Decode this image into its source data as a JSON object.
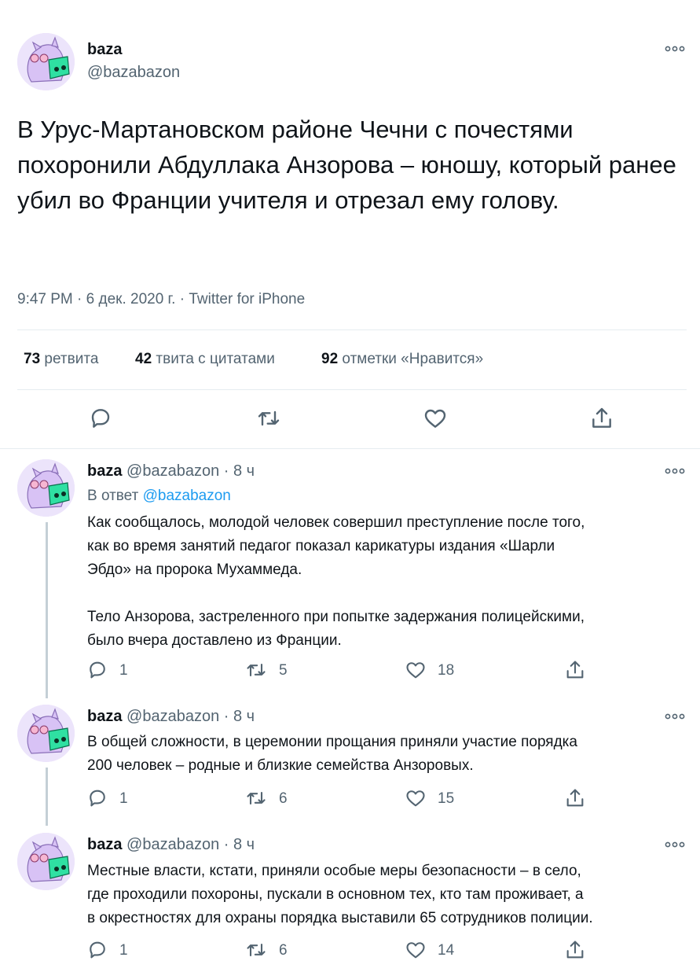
{
  "main": {
    "name": "baza",
    "handle": "@bazabazon",
    "text": "В Урус-Мартановском районе Чечни с почестями похоронили Абдуллака Анзорова – юношу, который ранее убил во Франции учителя и отрезал ему голову.",
    "meta": "9:47 PM · 6 дек. 2020 г. · Twitter for iPhone",
    "stats": {
      "retweets_num": "73",
      "retweets_label": "ретвита",
      "quotes_num": "42",
      "quotes_label": "твита с цитатами",
      "likes_num": "92",
      "likes_label": "отметки «Нравится»"
    },
    "actions": [
      "reply-icon",
      "retweet-icon",
      "like-icon",
      "share-icon"
    ]
  },
  "replies": [
    {
      "name": "baza",
      "handle": "@bazabazon",
      "dot": "·",
      "time": "8 ч",
      "reply_prefix": "В ответ",
      "reply_to": "@bazabazon",
      "text_lines": [
        "Как сообщалось, молодой человек совершил преступление после того,",
        "как во время занятий педагог показал карикатуры издания «Шарли",
        "Эбдо» на пророка Мухаммеда.",
        "",
        "Тело Анзорова, застреленного при попытке задержания полицейскими,",
        "было вчера доставлено из Франции."
      ],
      "replies": "1",
      "retweets": "5",
      "likes": "18"
    },
    {
      "name": "baza",
      "handle": "@bazabazon",
      "dot": "·",
      "time": "8 ч",
      "text_lines": [
        "В общей сложности, в церемонии прощания приняли участие порядка",
        "200 человек – родные и близкие семейства Анзоровых."
      ],
      "replies": "1",
      "retweets": "6",
      "likes": "15"
    },
    {
      "name": "baza",
      "handle": "@bazabazon",
      "dot": "·",
      "time": "8 ч",
      "text_lines": [
        "Местные власти, кстати, приняли особые меры безопасности – в село,",
        "где проходили похороны, пускали в основном тех, кто там проживает, а",
        "в окрестностях для охраны порядка выставили 65 сотрудников полиции."
      ],
      "replies": "1",
      "retweets": "6",
      "likes": "14"
    }
  ]
}
